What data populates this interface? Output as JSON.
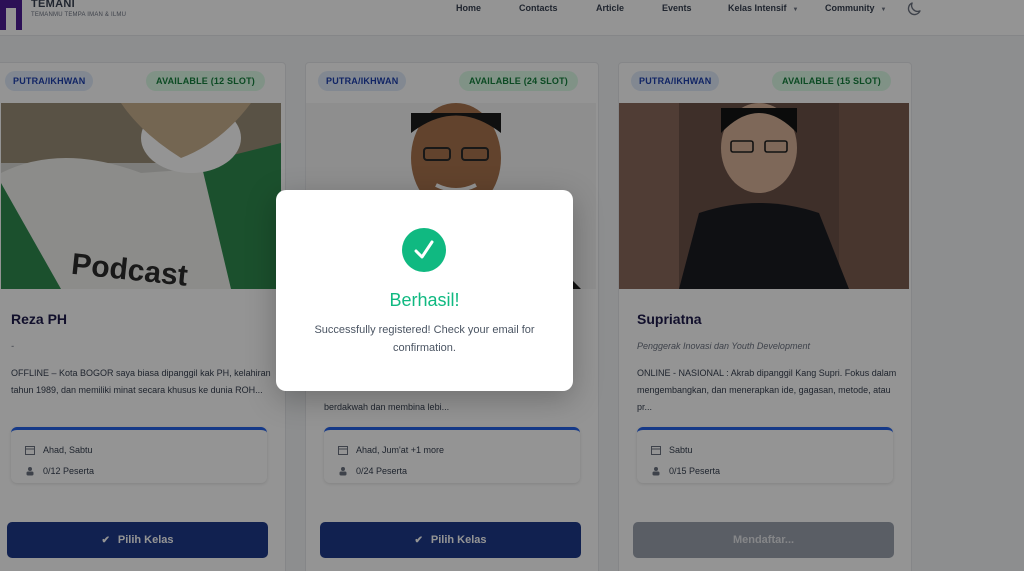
{
  "header": {
    "brand_name": "TEMANI",
    "brand_tagline": "TEMANMU TEMPA IMAN & ILMU",
    "nav": [
      {
        "label": "Home"
      },
      {
        "label": "Contacts"
      },
      {
        "label": "Article"
      },
      {
        "label": "Events"
      },
      {
        "label": "Kelas Intensif"
      },
      {
        "label": "Community"
      }
    ],
    "theme_toggle_icon": "moon-icon"
  },
  "cards": [
    {
      "gender_badge": "PUTRA/IKHWAN",
      "slot_badge": "AVAILABLE (12 SLOT)",
      "name": "Reza PH",
      "subtitle": "-",
      "description": "OFFLINE – Kota BOGOR saya biasa dipanggil kak PH, kelahiran tahun 1989, dan memiliki minat secara khusus ke dunia ROH...",
      "schedule": "Ahad, Sabtu",
      "participants": "0/12 Peserta",
      "button_label": "Pilih Kelas"
    },
    {
      "gender_badge": "PUTRA/IKHWAN",
      "slot_badge": "AVAILABLE (24 SLOT)",
      "name": "",
      "subtitle": "",
      "description": "berdakwah dan membina lebi...",
      "schedule": "Ahad, Jum'at +1 more",
      "participants": "0/24 Peserta",
      "button_label": "Pilih Kelas"
    },
    {
      "gender_badge": "PUTRA/IKHWAN",
      "slot_badge": "AVAILABLE (15 SLOT)",
      "name": "Supriatna",
      "subtitle": "Penggerak Inovasi dan Youth Development",
      "description": "ONLINE - NASIONAL : Akrab dipanggil Kang Supri. Fokus dalam mengembangkan, dan menerapkan ide, gagasan, metode, atau pr...",
      "schedule": "Sabtu",
      "participants": "0/15 Peserta",
      "button_label": "Mendaftar..."
    }
  ],
  "modal": {
    "title": "Berhasil!",
    "message": "Successfully registered! Check your email for confirmation.",
    "icon": "check-circle-icon"
  },
  "colors": {
    "primary_button": "#1e3a8a",
    "success": "#10b981",
    "badge_blue_bg": "#e0ebfa",
    "badge_green_bg": "#dcfce7"
  }
}
